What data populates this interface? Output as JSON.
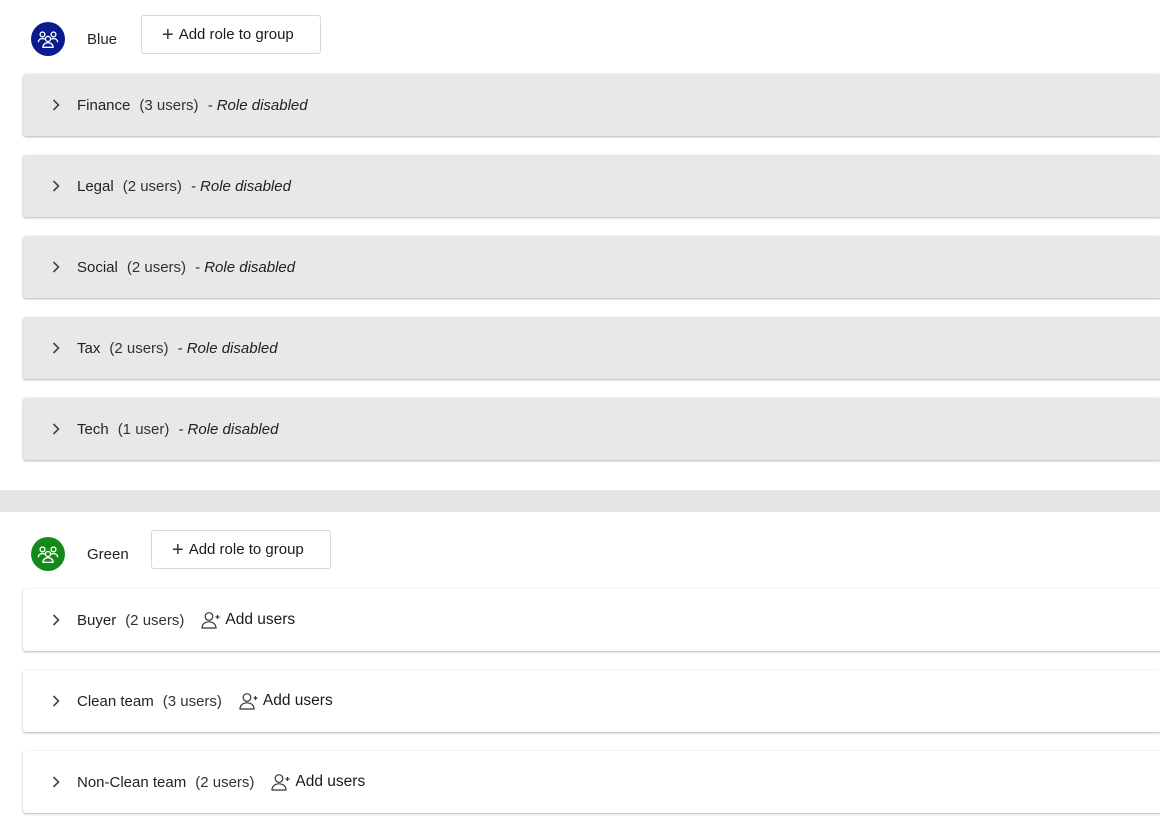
{
  "groups": [
    {
      "name": "Blue",
      "avatar_color": "#0a1a8f",
      "add_role_label": "Add role to group",
      "roles": [
        {
          "name": "Finance",
          "count": "(3 users)",
          "status": "- Role disabled"
        },
        {
          "name": "Legal",
          "count": "(2 users)",
          "status": "- Role disabled"
        },
        {
          "name": "Social",
          "count": "(2 users)",
          "status": "- Role disabled"
        },
        {
          "name": "Tax",
          "count": "(2 users)",
          "status": "- Role disabled"
        },
        {
          "name": "Tech",
          "count": "(1 user)",
          "status": "- Role disabled"
        }
      ]
    },
    {
      "name": "Green",
      "avatar_color": "#138a1a",
      "add_role_label": "Add role to group",
      "roles": [
        {
          "name": "Buyer",
          "count": "(2 users)",
          "action": "Add users"
        },
        {
          "name": "Clean team",
          "count": "(3 users)",
          "action": "Add users"
        },
        {
          "name": "Non-Clean team",
          "count": "(2 users)",
          "action": "Add users"
        }
      ]
    }
  ],
  "icons": {
    "group_avatar": "group-icon",
    "expand": "chevron-right-icon",
    "add_role": "plus-icon",
    "add_users": "add-user-icon"
  }
}
